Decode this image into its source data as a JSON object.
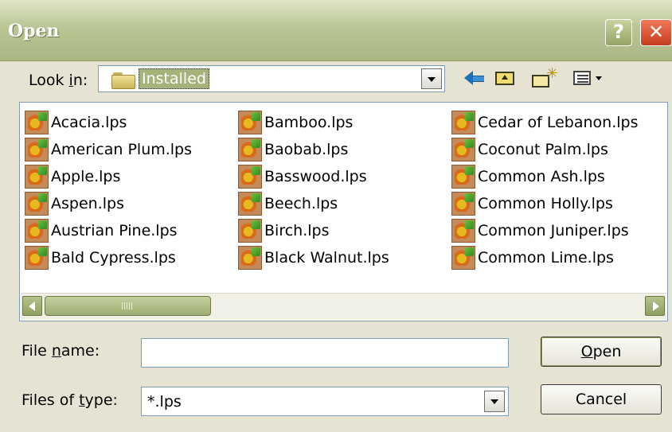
{
  "dialog": {
    "title": "Open",
    "help_label": "?",
    "close_label": "✕"
  },
  "look_in": {
    "label_prefix": "Look ",
    "label_mnemonic": "i",
    "label_suffix": "n:",
    "value": "Installed"
  },
  "toolbar": {
    "icons": [
      "back-arrow-icon",
      "up-one-level-icon",
      "create-new-folder-icon",
      "views-menu-icon"
    ]
  },
  "files": {
    "columns": [
      [
        "Acacia.lps",
        "American Plum.lps",
        "Apple.lps",
        "Aspen.lps",
        "Austrian Pine.lps",
        "Bald Cypress.lps"
      ],
      [
        "Bamboo.lps",
        "Baobab.lps",
        "Basswood.lps",
        "Beech.lps",
        "Birch.lps",
        "Black Walnut.lps"
      ],
      [
        "Cedar of Lebanon.lps",
        "Coconut Palm.lps",
        "Common Ash.lps",
        "Common Holly.lps",
        "Common Juniper.lps",
        "Common Lime.lps"
      ]
    ]
  },
  "file_name": {
    "label_prefix": "File ",
    "label_mnemonic": "n",
    "label_suffix": "ame:",
    "value": ""
  },
  "file_type": {
    "label_prefix": "Files of ",
    "label_mnemonic": "t",
    "label_suffix": "ype:",
    "value": "*.lps"
  },
  "buttons": {
    "open_mnemonic": "O",
    "open_suffix": "pen",
    "cancel": "Cancel"
  },
  "colors": {
    "title_bar": "#aab884",
    "selection": "#a5b27a",
    "close_button": "#c73b1e"
  }
}
